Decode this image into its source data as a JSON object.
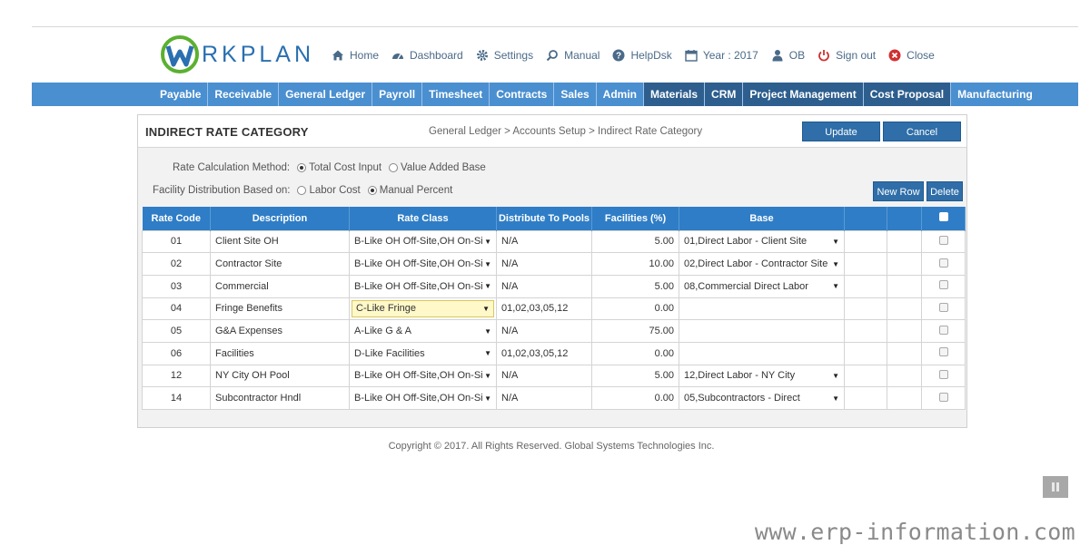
{
  "brand": {
    "logo_text": "RKPLAN",
    "primary_color": "#2f7dc6",
    "nav_color": "#4a8fd0",
    "accent_green": "#5bb030"
  },
  "toplinks": [
    {
      "icon": "home-icon",
      "label": "Home"
    },
    {
      "icon": "dashboard-icon",
      "label": "Dashboard"
    },
    {
      "icon": "gear-icon",
      "label": "Settings"
    },
    {
      "icon": "manual-icon",
      "label": "Manual"
    },
    {
      "icon": "help-icon",
      "label": "HelpDsk"
    },
    {
      "icon": "calendar-icon",
      "label": "Year : 2017"
    },
    {
      "icon": "user-icon",
      "label": "OB"
    },
    {
      "icon": "power-icon",
      "label": "Sign out"
    },
    {
      "icon": "close-icon",
      "label": "Close"
    }
  ],
  "nav": [
    "Payable",
    "Receivable",
    "General Ledger",
    "Payroll",
    "Timesheet",
    "Contracts",
    "Sales",
    "Admin",
    "Materials",
    "CRM",
    "Project Management",
    "Cost Proposal",
    "Manufacturing"
  ],
  "page": {
    "title": "INDIRECT RATE CATEGORY",
    "breadcrumb": "General Ledger > Accounts Setup > Indirect Rate Category",
    "update_label": "Update",
    "cancel_label": "Cancel",
    "new_row_label": "New Row",
    "delete_label": "Delete"
  },
  "options": {
    "rate_method_label": "Rate Calculation Method:",
    "rate_method_options": [
      "Total Cost Input",
      "Value Added Base"
    ],
    "rate_method_selected": "Total Cost Input",
    "facility_label": "Facility Distribution Based on:",
    "facility_options": [
      "Labor Cost",
      "Manual Percent"
    ],
    "facility_selected": "Manual Percent"
  },
  "table": {
    "headers": [
      "Rate Code",
      "Description",
      "Rate Class",
      "Distribute To Pools",
      "Facilities (%)",
      "Base"
    ],
    "rows": [
      {
        "code": "01",
        "desc": "Client Site OH",
        "rate_class": "B-Like OH Off-Site,OH On-Sit",
        "pools": "N/A",
        "facilities": "5.00",
        "base": "01,Direct Labor - Client Site"
      },
      {
        "code": "02",
        "desc": "Contractor Site",
        "rate_class": "B-Like OH Off-Site,OH On-Sit",
        "pools": "N/A",
        "facilities": "10.00",
        "base": "02,Direct Labor - Contractor Site"
      },
      {
        "code": "03",
        "desc": "Commercial",
        "rate_class": "B-Like OH Off-Site,OH On-Sit",
        "pools": "N/A",
        "facilities": "5.00",
        "base": "08,Commercial Direct Labor"
      },
      {
        "code": "04",
        "desc": "Fringe Benefits",
        "rate_class": "C-Like Fringe",
        "pools": "01,02,03,05,12",
        "facilities": "0.00",
        "base": ""
      },
      {
        "code": "05",
        "desc": "G&A Expenses",
        "rate_class": "A-Like G & A",
        "pools": "N/A",
        "facilities": "75.00",
        "base": ""
      },
      {
        "code": "06",
        "desc": "Facilities",
        "rate_class": "D-Like Facilities",
        "pools": "01,02,03,05,12",
        "facilities": "0.00",
        "base": ""
      },
      {
        "code": "12",
        "desc": "NY City OH Pool",
        "rate_class": "B-Like OH Off-Site,OH On-Sit",
        "pools": "N/A",
        "facilities": "5.00",
        "base": "12,Direct Labor - NY City"
      },
      {
        "code": "14",
        "desc": "Subcontractor Hndl",
        "rate_class": "B-Like OH Off-Site,OH On-Sit",
        "pools": "N/A",
        "facilities": "0.00",
        "base": "05,Subcontractors - Direct"
      }
    ]
  },
  "footer": "Copyright © 2017. All Rights Reserved. Global Systems Technologies Inc.",
  "watermark": "www.erp-information.com"
}
